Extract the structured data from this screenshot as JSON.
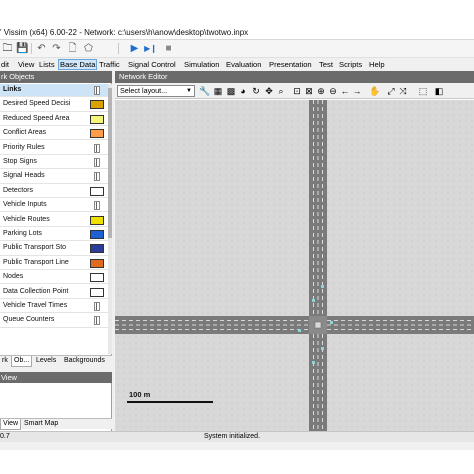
{
  "window": {
    "title": "' Vissim (x64) 6.00-22 - Network: c:\\users\\h\\anow\\desktop\\twotwo.inpx"
  },
  "quick_toolbar": {
    "icons": [
      "open-folder-icon",
      "save-icon",
      "undo-icon",
      "redo-icon",
      "open-file-icon",
      "network-icon",
      "play-icon",
      "step-icon",
      "stop-icon"
    ],
    "glyphs": [
      "🗀",
      "💾",
      "↶",
      "↷",
      "🗋",
      "⬠",
      "▶",
      "▶❙",
      "■"
    ]
  },
  "menu": {
    "items": [
      "dit",
      "View",
      "Lists",
      "Base Data",
      "Traffic",
      "Signal Control",
      "Simulation",
      "Evaluation",
      "Presentation",
      "Test",
      "Scripts",
      "Help"
    ],
    "active": "Base Data"
  },
  "network_objects": {
    "header": "rk Objects",
    "items": [
      {
        "label": "Links",
        "selected": true,
        "swatch": "thin",
        "color": "#666666"
      },
      {
        "label": "Desired Speed Decisi",
        "swatch": "box",
        "color": "#d9a200"
      },
      {
        "label": "Reduced Speed Area",
        "swatch": "box",
        "color": "#f5f57a"
      },
      {
        "label": "Conflict Areas",
        "swatch": "box",
        "color": "#ff9c4a"
      },
      {
        "label": "Priority Rules",
        "swatch": "thin",
        "color": "#c03030"
      },
      {
        "label": "Stop Signs",
        "swatch": "thin",
        "color": "#c03030"
      },
      {
        "label": "Signal Heads",
        "swatch": "thin",
        "color": "#c03030"
      },
      {
        "label": "Detectors",
        "swatch": "box",
        "color": "#ffffff"
      },
      {
        "label": "Vehicle Inputs",
        "swatch": "thin",
        "color": "#555555"
      },
      {
        "label": "Vehicle Routes",
        "swatch": "box",
        "color": "#f0e000"
      },
      {
        "label": "Parking Lots",
        "swatch": "box",
        "color": "#1c62d4"
      },
      {
        "label": "Public Transport Sto",
        "swatch": "box",
        "color": "#2a3d9a"
      },
      {
        "label": "Public Transport Line",
        "swatch": "box",
        "color": "#e06a20"
      },
      {
        "label": "Nodes",
        "swatch": "box",
        "color": "#ffffff"
      },
      {
        "label": "Data Collection Point",
        "swatch": "box",
        "color": "#ffffff"
      },
      {
        "label": "Vehicle Travel Times",
        "swatch": "thin",
        "color": "#555555"
      },
      {
        "label": "Queue Counters",
        "swatch": "thin",
        "color": "#555555"
      }
    ],
    "tabs": [
      "rk",
      "Ob...",
      "Levels",
      "Backgrounds"
    ],
    "active_tab": "Ob..."
  },
  "quick_view": {
    "header": "View",
    "tabs": [
      "View",
      "Smart Map"
    ],
    "active_tab": "View"
  },
  "network_editor": {
    "header": "Network Editor",
    "layout_select": "Select layout...",
    "tools": [
      {
        "name": "wrench-icon",
        "glyph": "🔧"
      },
      {
        "name": "grid-icon",
        "glyph": "▦"
      },
      {
        "name": "bitmap-icon",
        "glyph": "▩"
      },
      {
        "name": "globe-icon",
        "glyph": "◕"
      },
      {
        "name": "sync-icon",
        "glyph": "↻"
      },
      {
        "name": "pan-icon",
        "glyph": "✥"
      },
      {
        "name": "zoom-area-icon",
        "glyph": "⌕"
      },
      {
        "name": "zoom-all-icon",
        "glyph": "⊡"
      },
      {
        "name": "zoom-network-icon",
        "glyph": "⊠"
      },
      {
        "name": "zoom-in-icon",
        "glyph": "⊕"
      },
      {
        "name": "zoom-out-icon",
        "glyph": "⊖"
      },
      {
        "name": "back-icon",
        "glyph": "←"
      },
      {
        "name": "forward-icon",
        "glyph": "→"
      },
      {
        "name": "hand-icon",
        "glyph": "✋"
      },
      {
        "name": "move-icon",
        "glyph": "⤢"
      },
      {
        "name": "direction-icon",
        "glyph": "⤨"
      },
      {
        "name": "style-icon",
        "glyph": "⬚"
      },
      {
        "name": "display-icon",
        "glyph": "◧"
      }
    ],
    "scale_label": "100 m",
    "colors": {
      "road": "#7a7a7a",
      "lane_mark": "#f5f5f5",
      "connector": "#8fd3d6",
      "canvas": "#d8d8d8"
    }
  },
  "status": {
    "left": "0.7",
    "main": "System initialized."
  }
}
